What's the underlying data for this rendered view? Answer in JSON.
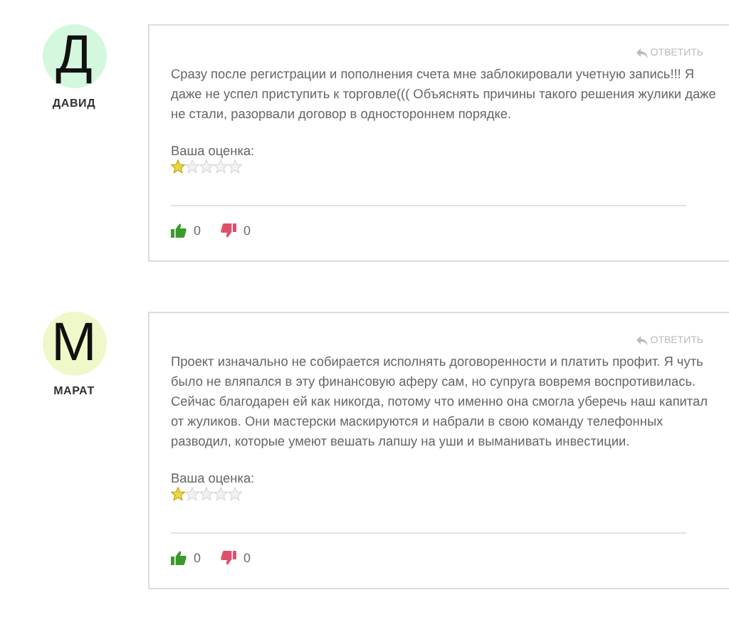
{
  "comments": [
    {
      "author": "ДАВИД",
      "initial": "Д",
      "color": "#d4f8dd",
      "reply": "ОТВЕТИТЬ",
      "text": "Сразу после регистрации и пополнения счета мне заблокировали учетную запись!!! Я даже не успел приступить к торговле((( Объяснять причины такого решения жулики даже не стали, разорвали договор в одностороннем порядке.",
      "rating_label": "Ваша оценка:",
      "stars": 1,
      "likes": "0",
      "dislikes": "0"
    },
    {
      "author": "МАРАТ",
      "initial": "М",
      "color": "#eef8c8",
      "reply": "ОТВЕТИТЬ",
      "text": "Проект изначально не собирается исполнять договоренности и платить профит. Я чуть было не вляпался в эту финансовую аферу сам, но супруга вовремя воспротивилась. Сейчас благодарен ей как никогда, потому что именно она смогла уберечь наш капитал от жуликов. Они мастерски маскируются и набрали в свою команду телефонных разводил, которые умеют вешать лапшу на уши и выманивать инвестиции.",
      "rating_label": "Ваша оценка:",
      "stars": 1,
      "likes": "0",
      "dislikes": "0"
    }
  ]
}
